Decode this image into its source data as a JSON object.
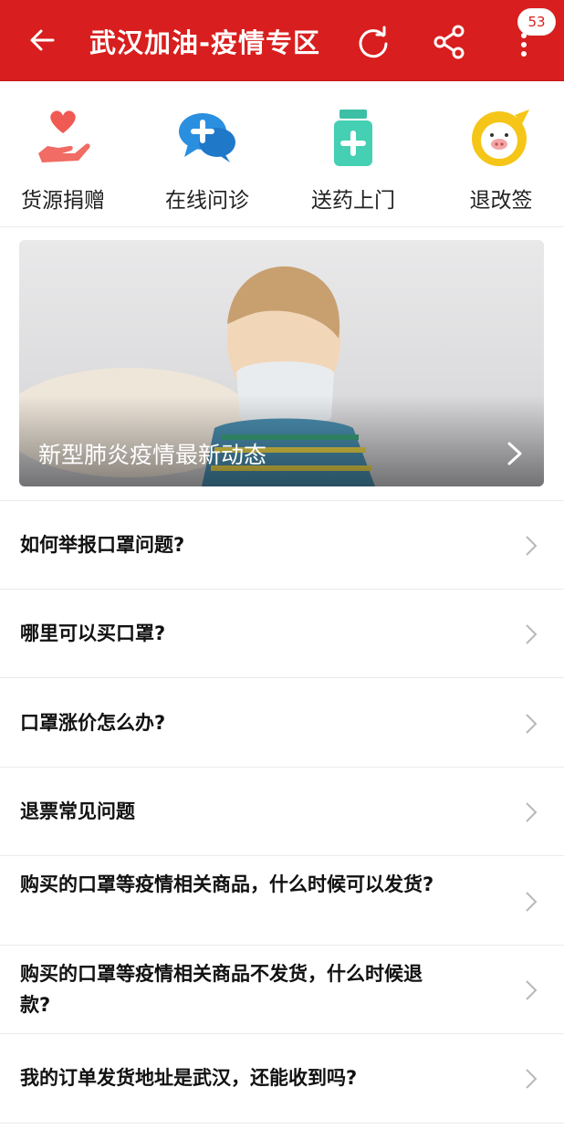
{
  "header": {
    "title": "武汉加油-疫情专区",
    "badge_count": "53",
    "icons": [
      "back-arrow-icon",
      "refresh-icon",
      "share-icon",
      "more-icon"
    ],
    "background_color": "#d81e1e"
  },
  "quick_actions": [
    {
      "label": "货源捐赠",
      "icon": "heart-hand-icon"
    },
    {
      "label": "在线问诊",
      "icon": "chat-medical-icon"
    },
    {
      "label": "送药上门",
      "icon": "medicine-bottle-icon"
    },
    {
      "label": "退改签",
      "icon": "pig-mascot-icon"
    }
  ],
  "banner": {
    "caption": "新型肺炎疫情最新动态"
  },
  "faq_items": [
    {
      "text": "如何举报口罩问题?"
    },
    {
      "text": "哪里可以买口罩?"
    },
    {
      "text": "口罩涨价怎么办?"
    },
    {
      "text": "退票常见问题"
    },
    {
      "text": "购买的口罩等疫情相关商品，什么时候可以发货?"
    },
    {
      "text": "购买的口罩等疫情相关商品不发货，什么时候退款?"
    },
    {
      "text": "我的订单发货地址是武汉，还能收到吗?"
    }
  ]
}
